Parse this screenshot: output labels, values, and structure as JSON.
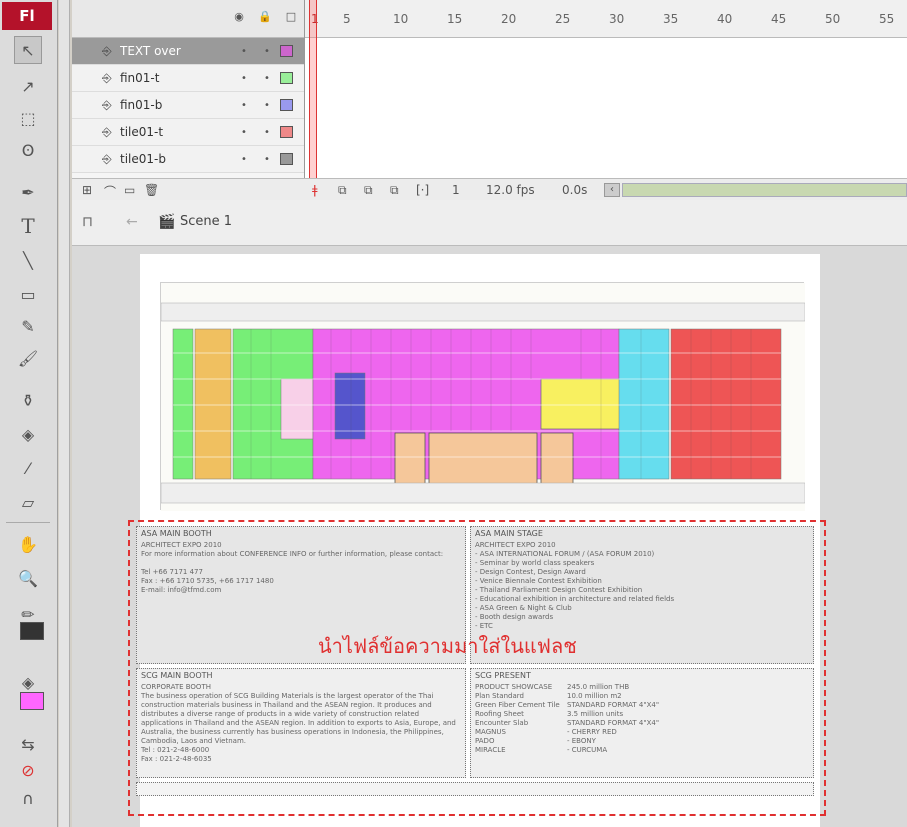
{
  "app": {
    "logo": "Fl"
  },
  "toolbar": {
    "tools": [
      {
        "name": "selection-tool",
        "icon": "↖"
      },
      {
        "name": "subselection-tool",
        "icon": "↗"
      },
      {
        "name": "free-transform-tool",
        "icon": "⬚"
      },
      {
        "name": "lasso-tool",
        "icon": "ʘ"
      },
      {
        "name": "pen-tool",
        "icon": "✒"
      },
      {
        "name": "text-tool",
        "icon": "T"
      },
      {
        "name": "line-tool",
        "icon": "╲"
      },
      {
        "name": "rectangle-tool",
        "icon": "▭"
      },
      {
        "name": "pencil-tool",
        "icon": "✎"
      },
      {
        "name": "brush-tool",
        "icon": "🖌"
      },
      {
        "name": "ink-bottle-tool",
        "icon": "⚱"
      },
      {
        "name": "paint-bucket-tool",
        "icon": "◈"
      },
      {
        "name": "eyedropper-tool",
        "icon": "⁄"
      },
      {
        "name": "eraser-tool",
        "icon": "▱"
      },
      {
        "name": "hand-tool",
        "icon": "✋"
      },
      {
        "name": "zoom-tool",
        "icon": "🔍"
      }
    ],
    "stroke_color": "#333333",
    "fill_color": "#ff66ff"
  },
  "timeline": {
    "layers": [
      {
        "name": "TEXT over",
        "color": "#cc66cc",
        "selected": true
      },
      {
        "name": "fin01-t",
        "color": "#99ee99",
        "selected": false
      },
      {
        "name": "fin01-b",
        "color": "#9999ee",
        "selected": false
      },
      {
        "name": "tile01-t",
        "color": "#ee8888",
        "selected": false
      },
      {
        "name": "tile01-b",
        "color": "#999999",
        "selected": false
      }
    ],
    "ruler": [
      "1",
      "5",
      "10",
      "15",
      "20",
      "25",
      "30",
      "35",
      "40",
      "45",
      "50",
      "55"
    ],
    "current_frame": "1",
    "fps": "12.0 fps",
    "time": "0.0s"
  },
  "edit_bar": {
    "scene": "Scene 1"
  },
  "stage": {
    "overlay_text": "นำไฟล์ข้อความมาใส่ในแฟลช",
    "panels": {
      "tl_title": "ASA MAIN BOOTH",
      "tl_text": "ARCHITECT EXPO 2010\nFor more information about CONFERENCE INFO or further information, please contact:\n\nTel  +66 7171 477\nFax : +66 1710 5735, +66 1717 1480\nE-mail: info@tfmd.com",
      "tr_title": "ASA MAIN STAGE",
      "tr_text": "ARCHITECT EXPO 2010\n- ASA INTERNATIONAL FORUM / (ASA FORUM 2010)\n- Seminar by world class speakers\n- Design Contest, Design Award\n- Venice Biennale Contest Exhibition\n- Thailand Parliament Design Contest Exhibition\n- Educational exhibition in architecture and related fields\n- ASA Green & Night & Club\n- Booth design awards\n- ETC",
      "bl_title": "SCG MAIN BOOTH",
      "bl_text": "CORPORATE BOOTH\nThe business operation of SCG Building Materials is the largest operator of the Thai construction materials business in Thailand and the ASEAN region. It produces and distributes a diverse range of products in a wide variety of construction related applications in Thailand and the ASEAN region. In addition to exports to Asia, Europe, and Australia, the business currently has business operations in Indonesia, the Philippines, Cambodia, Laos and Vietnam.\nTel : 021-2-48-6000\nFax : 021-2-48-6035",
      "br_title": "SCG PRESENT",
      "br_text": "PRODUCT SHOWCASE\nPlan Standard\nGreen Fiber Cement Tile\nRoofing Sheet\nEncounter Slab\nMAGNUS\nPADO\nMIRACLE",
      "br_right": "245.0 million THB\n10.0 million m2\nSTANDARD FORMAT 4\"X4\"\n3.5 million units\nSTANDARD FORMAT 4\"X4\"\n- CHERRY RED\n- EBONY\n- CURCUMA"
    }
  }
}
